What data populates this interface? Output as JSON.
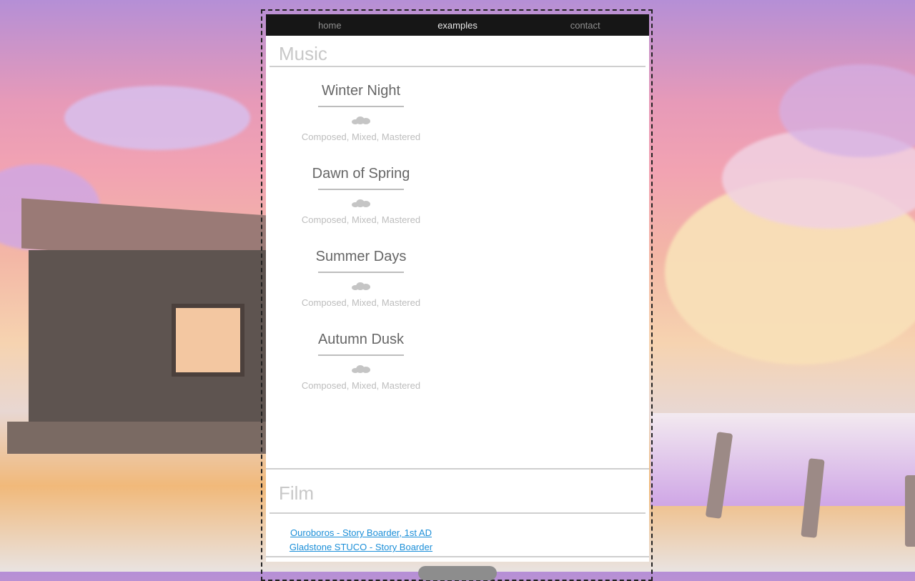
{
  "nav": {
    "items": [
      {
        "label": "home",
        "active": false
      },
      {
        "label": "examples",
        "active": true
      },
      {
        "label": "contact",
        "active": false
      }
    ]
  },
  "music": {
    "title": "Music",
    "tracks": [
      {
        "title": "Winter Night",
        "icon": "soundcloud-icon",
        "desc": "Composed, Mixed, Mastered"
      },
      {
        "title": "Dawn of Spring",
        "icon": "soundcloud-icon",
        "desc": "Composed, Mixed, Mastered"
      },
      {
        "title": "Summer Days",
        "icon": "soundcloud-icon",
        "desc": "Composed, Mixed, Mastered"
      },
      {
        "title": "Autumn Dusk",
        "icon": "soundcloud-icon",
        "desc": "Composed, Mixed, Mastered"
      }
    ]
  },
  "film": {
    "title": "Film",
    "links": [
      "Ouroboros - Story Boarder, 1st AD",
      "Gladstone STUCO - Story Boarder"
    ]
  },
  "colors": {
    "nav_bg": "#161616",
    "link": "#1c8fd8",
    "section_title": "#c8c8c8"
  }
}
